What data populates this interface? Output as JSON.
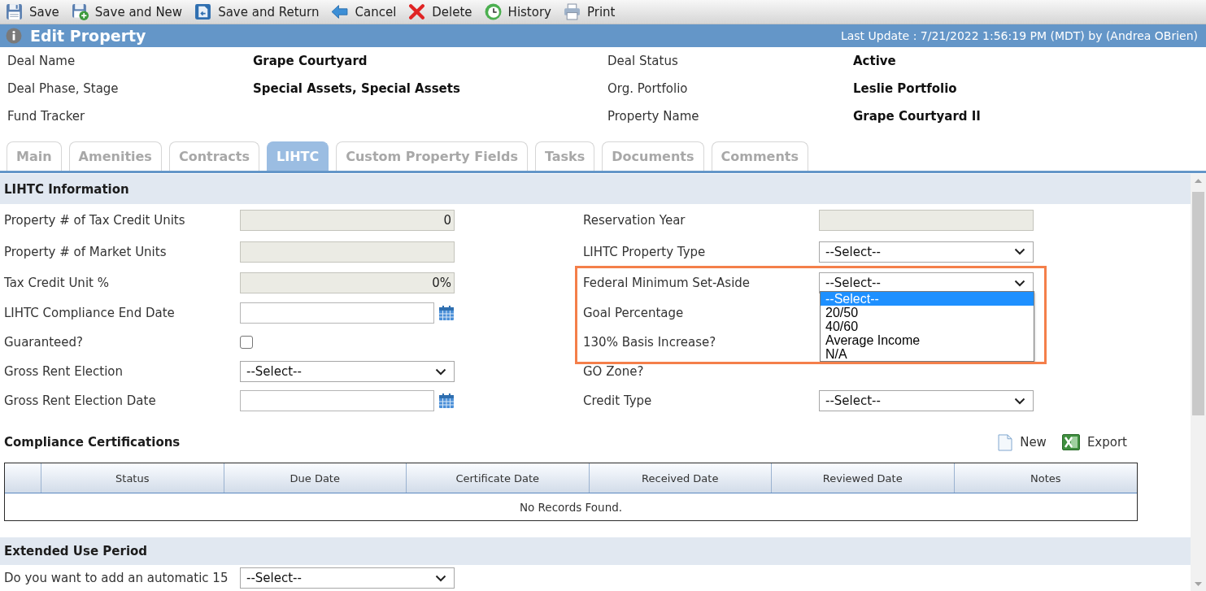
{
  "toolbar": {
    "buttons": [
      {
        "kind": "save",
        "label": "Save"
      },
      {
        "kind": "save_new",
        "label": "Save and New"
      },
      {
        "kind": "save_return",
        "label": "Save and Return"
      },
      {
        "kind": "cancel",
        "label": "Cancel"
      },
      {
        "kind": "delete",
        "label": "Delete"
      },
      {
        "kind": "history",
        "label": "History"
      },
      {
        "kind": "print",
        "label": "Print"
      }
    ]
  },
  "title_bar": {
    "title": "Edit Property",
    "last_update": "Last Update : 7/21/2022 1:56:19 PM (MDT) by (Andrea OBrien)"
  },
  "summary": [
    {
      "label": "Deal Name",
      "value": "Grape Courtyard"
    },
    {
      "label": "Deal Status",
      "value": "Active"
    },
    {
      "label": "Deal Phase, Stage",
      "value": "Special Assets, Special Assets"
    },
    {
      "label": "Org. Portfolio",
      "value": "Leslie Portfolio"
    },
    {
      "label": "Fund Tracker"
    },
    {
      "label": "Property Name",
      "value": "Grape Courtyard II"
    }
  ],
  "tabs": [
    {
      "label": "Main",
      "selected": false
    },
    {
      "label": "Amenities",
      "selected": false
    },
    {
      "label": "Contracts",
      "selected": false
    },
    {
      "label": "LIHTC",
      "selected": true
    },
    {
      "label": "Custom Property Fields",
      "selected": false
    },
    {
      "label": "Tasks",
      "selected": false
    },
    {
      "label": "Documents",
      "selected": false
    },
    {
      "label": "Comments",
      "selected": false
    }
  ],
  "lihtc_information": {
    "title": "LIHTC Information",
    "rows": [
      {
        "left": {
          "label": "Property # of Tax Credit Units",
          "kind": "readonly",
          "value": "0"
        },
        "right": {
          "label": "Reservation Year",
          "kind": "readonly"
        }
      },
      {
        "left": {
          "label": "Property # of Market Units",
          "kind": "readonly"
        },
        "right": {
          "label": "LIHTC Property Type",
          "kind": "select",
          "value": "--Select--"
        }
      },
      {
        "left": {
          "label": "Tax Credit Unit %",
          "kind": "readonly",
          "value": "0%"
        },
        "right": {
          "label": "Federal Minimum Set-Aside",
          "kind": "select",
          "value": "--Select--",
          "expanded": true,
          "highlighted": true,
          "options": [
            {
              "label": "--Select--",
              "selected": true
            },
            {
              "label": "20/50",
              "selected": false
            },
            {
              "label": "40/60",
              "selected": false
            },
            {
              "label": "Average Income",
              "selected": false
            },
            {
              "label": "N/A",
              "selected": false
            }
          ]
        }
      },
      {
        "left": {
          "label": "LIHTC Compliance End Date",
          "kind": "date"
        },
        "right": {
          "label": "Goal Percentage",
          "kind": "label"
        }
      },
      {
        "left": {
          "label": "Guaranteed?",
          "kind": "checkbox",
          "checked": false
        },
        "right": {
          "label": "130% Basis Increase?",
          "kind": "label"
        }
      },
      {
        "left": {
          "label": "Gross Rent Election",
          "kind": "select",
          "value": "--Select--"
        },
        "right": {
          "label": "GO Zone?",
          "kind": "label"
        }
      },
      {
        "left": {
          "label": "Gross Rent Election Date",
          "kind": "date"
        },
        "right": {
          "label": "Credit Type",
          "kind": "select",
          "value": "--Select--"
        }
      }
    ]
  },
  "compliance_certifications": {
    "title": "Compliance Certifications",
    "actions": [
      {
        "kind": "new",
        "label": "New"
      },
      {
        "kind": "export",
        "label": "Export"
      }
    ],
    "columns": [
      {
        "kind": "selector"
      },
      {
        "kind": "text",
        "label": "Status"
      },
      {
        "kind": "text",
        "label": "Due Date"
      },
      {
        "kind": "text",
        "label": "Certificate Date"
      },
      {
        "kind": "text",
        "label": "Received Date"
      },
      {
        "kind": "text",
        "label": "Reviewed Date"
      },
      {
        "kind": "text",
        "label": "Notes"
      }
    ],
    "empty_message": "No Records Found."
  },
  "extended_use_period": {
    "title": "Extended Use Period",
    "rows": [
      {
        "left": {
          "label": "Do you want to add an automatic 15",
          "kind": "select",
          "value": "--Select--"
        }
      }
    ]
  }
}
